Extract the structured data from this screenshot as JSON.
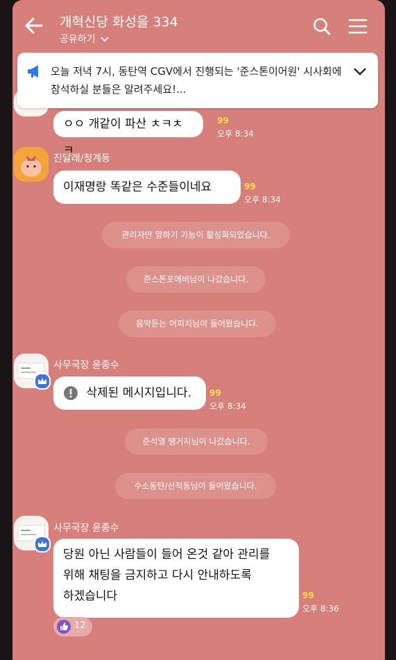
{
  "header": {
    "title": "개혁신당 화성을 334",
    "share_label": "공유하기"
  },
  "notice": {
    "text": "오늘 저녁 7시, 동탄역 CGV에서 진행되는 '준스톤이어원' 시사회에 참석하실 분들은 알려주세요!..."
  },
  "messages": [
    {
      "text": "ㅇㅇ 개같이 파산 ㅊㅋㅊㅋ",
      "read": "99",
      "time": "오후 8:34"
    },
    {
      "sender": "진달래/청계동",
      "text": "이재명랑 똑같은 수준들이네요",
      "read": "99",
      "time": "오후 8:34"
    },
    {
      "sender": "사무국장 윤종수",
      "text": "삭제된 메시지입니다.",
      "read": "99",
      "time": "오후 8:34"
    },
    {
      "sender": "사무국장 윤종수",
      "lines": [
        "당원 아닌 사람들이 들어 온것 같아 관리를",
        "위해 채팅을 금지하고 다시 안내하도록",
        "하겠습니다"
      ],
      "read": "99",
      "time": "오후 8:36",
      "reaction_count": "12"
    }
  ],
  "system_messages": [
    "관리자만 말하기 기능이 활성화되었습니다.",
    "준스톤포에버님이 나갔습니다.",
    "음악듣는 어피치님이 들어왔습니다.",
    "준석열 땡거지님이 나갔습니다.",
    "수소동탄/산척동님이 들어왔습니다."
  ],
  "colors": {
    "background": "#d77f7b",
    "read_count": "#ffe04a",
    "badge": "#3f74d6"
  },
  "icons": [
    "back-arrow-icon",
    "search-icon",
    "menu-icon",
    "megaphone-icon",
    "chevron-down-icon",
    "warning-icon",
    "thumbs-up-icon",
    "crown-icon"
  ]
}
